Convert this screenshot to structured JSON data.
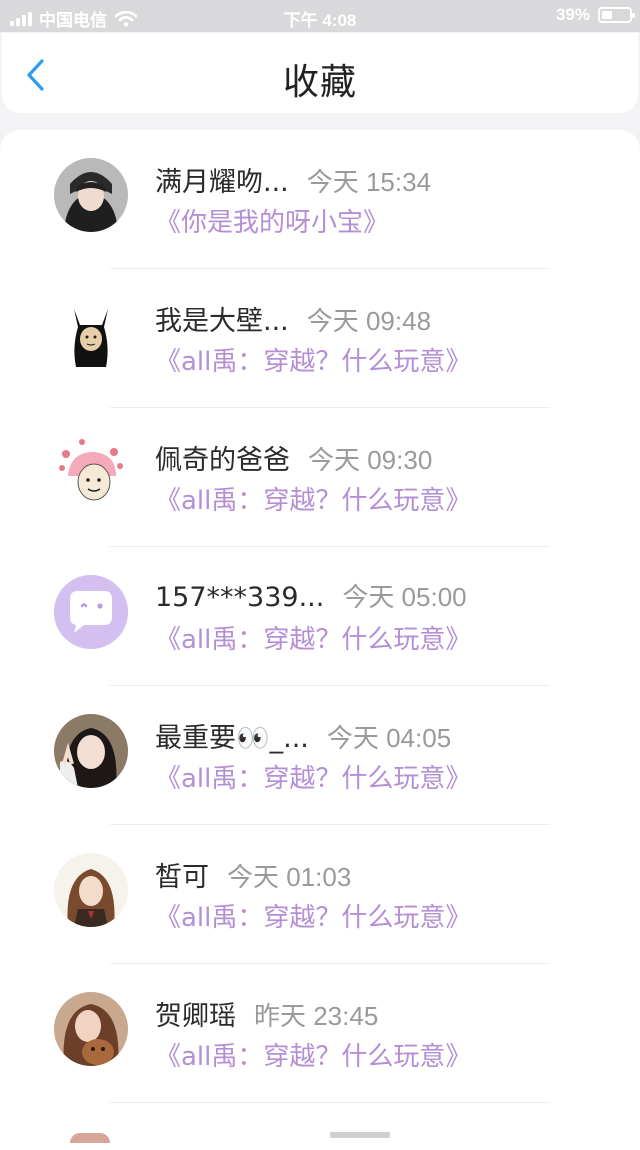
{
  "status_bar": {
    "carrier": "中国电信",
    "time": "下午 4:08",
    "battery": "39%",
    "battery_level": 0.39
  },
  "nav": {
    "title": "收藏",
    "back_icon": "chevron-left-icon"
  },
  "items": [
    {
      "name": "满月耀吻...",
      "time": "今天 15:34",
      "subtitle": "《你是我的呀小宝》"
    },
    {
      "name": "我是大壁...",
      "time": "今天 09:48",
      "subtitle": "《all禹：穿越？什么玩意》"
    },
    {
      "name": "佩奇的爸爸",
      "time": "今天 09:30",
      "subtitle": "《all禹：穿越？什么玩意》"
    },
    {
      "name": "157***339...",
      "time": "今天 05:00",
      "subtitle": "《all禹：穿越？什么玩意》"
    },
    {
      "name": "最重要👀_...",
      "time": "今天 04:05",
      "subtitle": "《all禹：穿越？什么玩意》"
    },
    {
      "name": "皙可",
      "time": "今天 01:03",
      "subtitle": "《all禹：穿越？什么玩意》"
    },
    {
      "name": "贺卿瑶",
      "time": "昨天 23:45",
      "subtitle": "《all禹：穿越？什么玩意》"
    }
  ],
  "colors": {
    "accent_blue": "#2c9cf0",
    "subtitle_purple": "#b48fd6",
    "default_avatar": "#d4c0f0"
  }
}
